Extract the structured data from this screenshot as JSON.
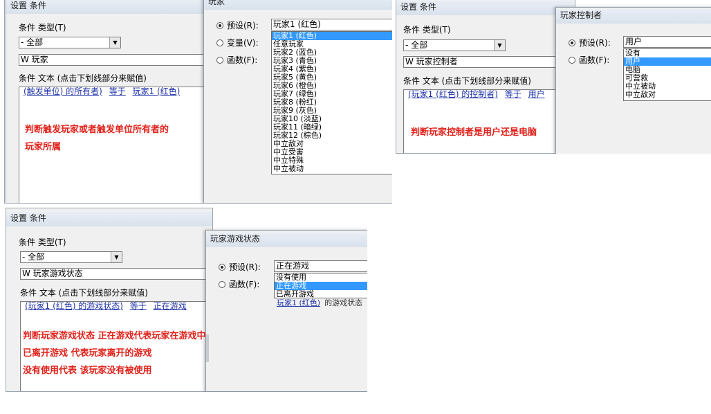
{
  "p1": {
    "window_title": "设置 条件",
    "type_label": "条件 类型(T)",
    "type_value": "- 全部",
    "search_value": "W 玩家",
    "text_label": "条件 文本 (点击下划线部分来赋值)",
    "link1": "(触发单位) 的所有者)",
    "link2": "等于",
    "link3": "玩家1 (红色)",
    "note1": "判断触发玩家或者触发单位所有者的",
    "note2": "玩家所属",
    "dialog_title": "玩家",
    "radio1": "预设(R):",
    "radio2": "变量(V):",
    "radio3": "函数(F):",
    "combo_value": "玩家1 (红色)",
    "options": [
      "玩家1 (红色)",
      "任意玩家",
      "玩家2 (蓝色)",
      "玩家3 (青色)",
      "玩家4 (紫色)",
      "玩家5 (黄色)",
      "玩家6 (橙色)",
      "玩家7 (绿色)",
      "玩家8 (粉红)",
      "玩家9 (灰色)",
      "玩家10 (淡蓝)",
      "玩家11 (暗绿)",
      "玩家12 (棕色)",
      "中立敌对",
      "中立受害",
      "中立特殊",
      "中立被动"
    ]
  },
  "p2": {
    "window_title": "设置 条件",
    "type_label": "条件 类型(T)",
    "type_value": "- 全部",
    "search_value": "W 玩家控制者",
    "text_label": "条件 文本 (点击下划线部分来赋值)",
    "link1": "(玩家1 (红色) 的控制者)",
    "link2": "等于",
    "link3": "用户",
    "note1": "判断玩家控制者是用户还是电脑",
    "dialog_title": "玩家控制者",
    "radio1": "预设(R):",
    "radio2": "函数(F):",
    "combo_value": "用户",
    "options": [
      "没有",
      "用户",
      "电脑",
      "可营救",
      "中立被动",
      "中立敌对"
    ]
  },
  "p3": {
    "window_title": "设置 条件",
    "type_label": "条件 类型(T)",
    "type_value": "- 全部",
    "search_value": "W 玩家游戏状态",
    "text_label": "条件 文本 (点击下划线部分来赋值)",
    "link1": "(玩家1 (红色) 的游戏状态)",
    "link2": "等于",
    "link3": "正在游戏",
    "note1": "判断玩家游戏状态 正在游戏代表玩家在游戏中",
    "note2": "已离开游戏 代表玩家离开的游戏",
    "note3": "没有使用代表 该玩家没有被使用",
    "dialog_title": "玩家游戏状态",
    "radio1": "预设(R):",
    "radio2": "函数(F):",
    "combo_value": "正在游戏",
    "options": [
      "没有使用",
      "正在游戏",
      "已离开游戏"
    ],
    "behind_text_link": "玩家1 (红色)",
    "behind_text_rest": "的游戏状态"
  }
}
